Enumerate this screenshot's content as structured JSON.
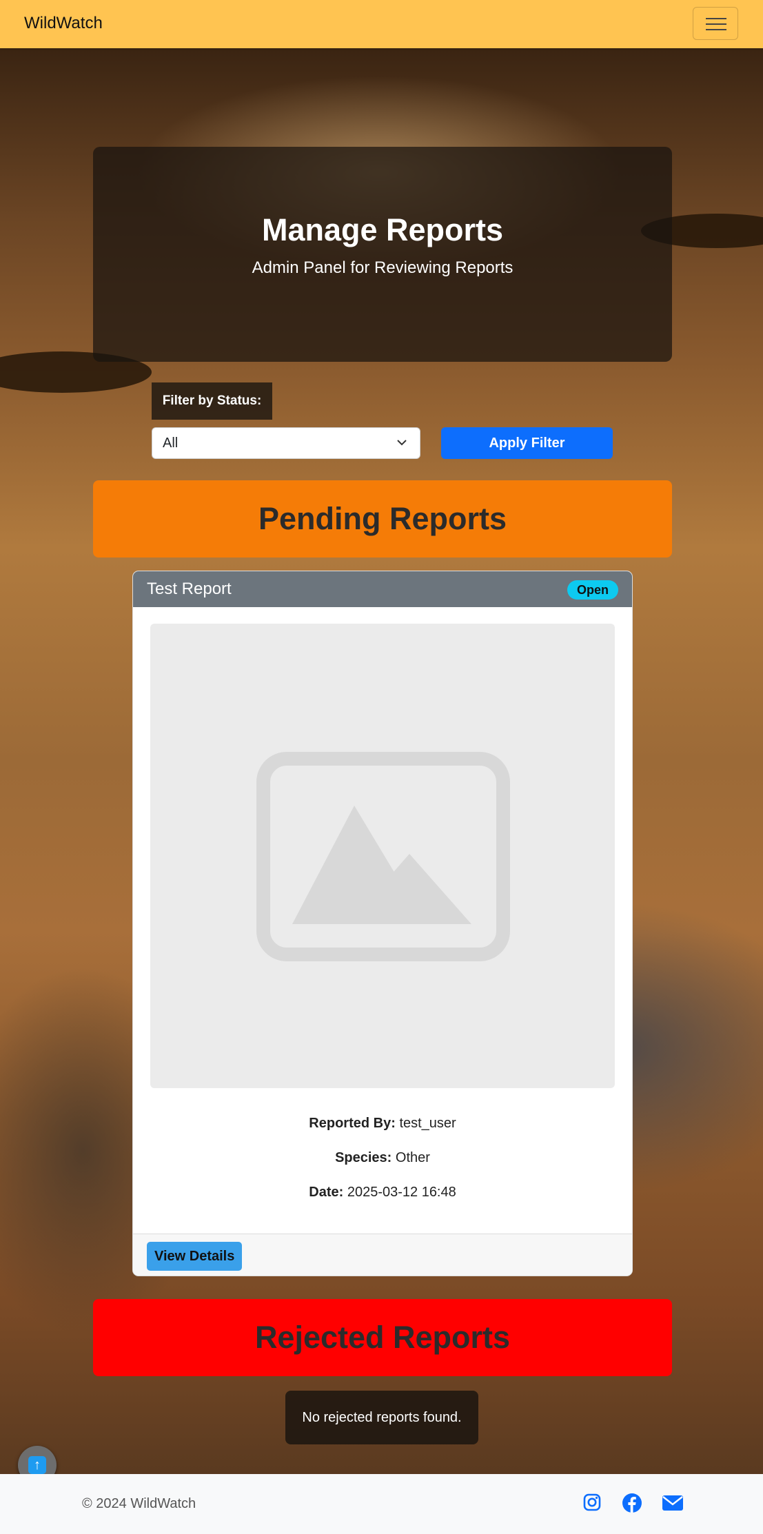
{
  "navbar": {
    "brand": "WildWatch",
    "menu_icon": "hamburger-menu-icon"
  },
  "hero": {
    "title": "Manage Reports",
    "subtitle": "Admin Panel for Reviewing Reports"
  },
  "filter": {
    "label": "Filter by Status:",
    "selected": "All",
    "apply_label": "Apply Filter"
  },
  "sections": {
    "pending_title": "Pending Reports",
    "rejected_title": "Rejected Reports",
    "rejected_empty": "No rejected reports found."
  },
  "report_card": {
    "title": "Test Report",
    "status": "Open",
    "image_icon": "image-placeholder-icon",
    "reported_by_label": "Reported By:",
    "reported_by_value": "test_user",
    "species_label": "Species:",
    "species_value": "Other",
    "date_label": "Date:",
    "date_value": "2025-03-12 16:48",
    "view_label": "View Details"
  },
  "footer": {
    "copyright": "© 2024 WildWatch",
    "social_icons": [
      "instagram-icon",
      "facebook-icon",
      "envelope-icon"
    ]
  },
  "colors": {
    "navbar": "#ffc451",
    "pending_banner": "#f57c07",
    "rejected_banner": "#ff0000",
    "primary": "#0d6efd",
    "badge": "#0dcaf0",
    "card_header": "#6c757d"
  }
}
